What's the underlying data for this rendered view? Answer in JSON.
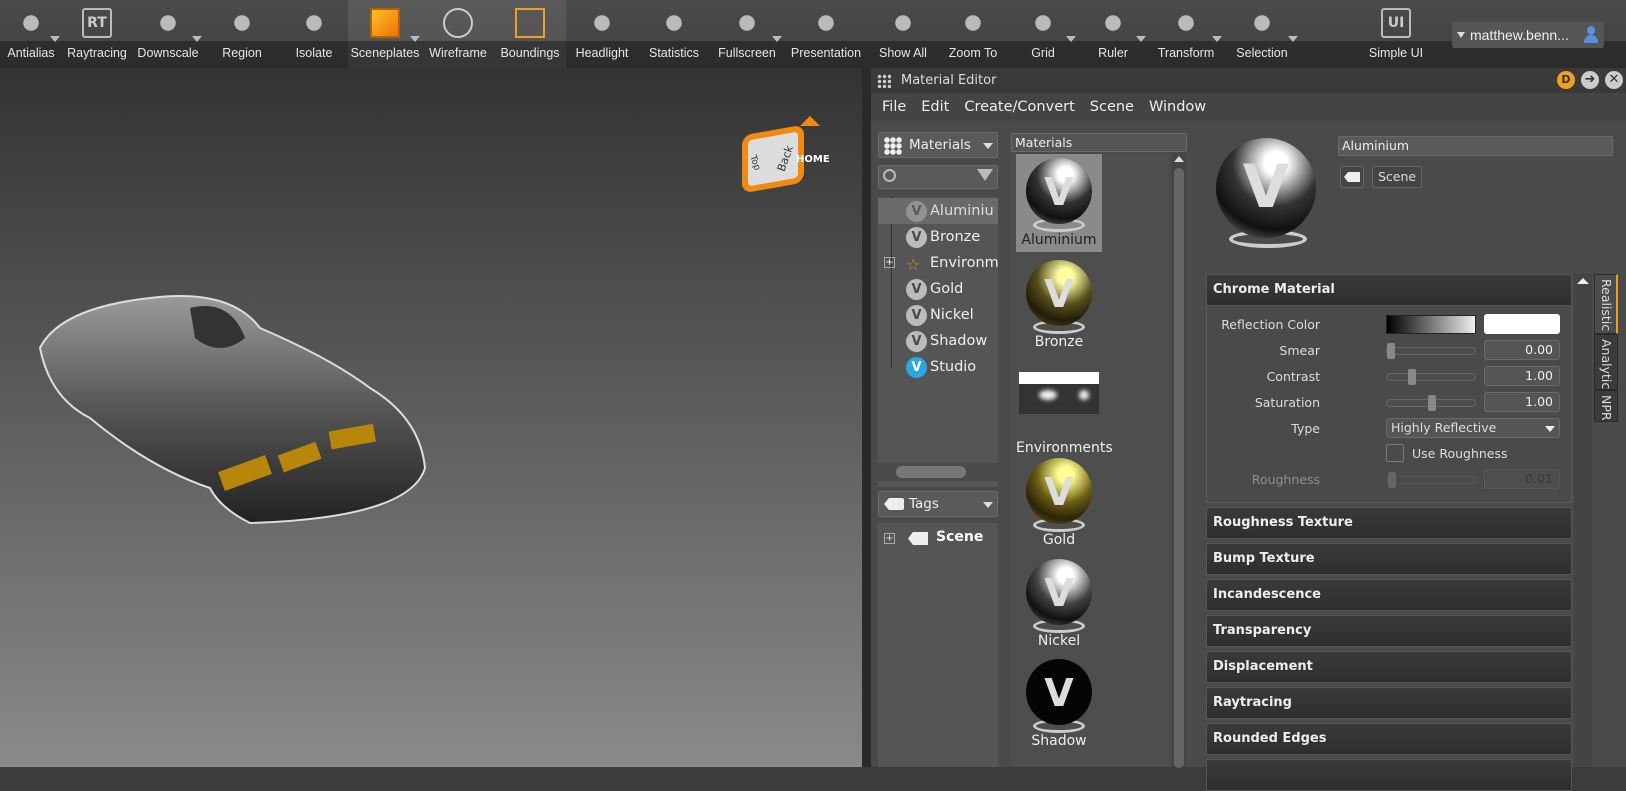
{
  "toolbar": {
    "items": [
      {
        "label": "Antialias",
        "icon": "antialias-grid-icon"
      },
      {
        "label": "Raytracing",
        "icon": "rt-icon",
        "glyph": "RT"
      },
      {
        "label": "Downscale",
        "icon": "downscale-icon"
      },
      {
        "label": "Region",
        "icon": "region-icon"
      },
      {
        "label": "Isolate",
        "icon": "isolate-eye-icon"
      },
      {
        "label": "Sceneplates",
        "icon": "sceneplates-icon"
      },
      {
        "label": "Wireframe",
        "icon": "wireframe-globe-icon"
      },
      {
        "label": "Boundings",
        "icon": "boundings-icon"
      },
      {
        "label": "Headlight",
        "icon": "headlight-icon"
      },
      {
        "label": "Statistics",
        "icon": "statistics-icon"
      },
      {
        "label": "Fullscreen",
        "icon": "fullscreen-icon"
      },
      {
        "label": "Presentation",
        "icon": "presentation-icon"
      },
      {
        "label": "Show All",
        "icon": "show-all-icon"
      },
      {
        "label": "Zoom To",
        "icon": "zoom-to-icon"
      },
      {
        "label": "Grid",
        "icon": "grid-icon"
      },
      {
        "label": "Ruler",
        "icon": "ruler-icon"
      },
      {
        "label": "Transform",
        "icon": "transform-icon"
      },
      {
        "label": "Selection",
        "icon": "selection-icon"
      },
      {
        "label": "Simple UI",
        "icon": "simple-ui-icon",
        "glyph": "UI"
      }
    ],
    "user": "matthew.benn..."
  },
  "viewport": {
    "navcube_home": "HOME",
    "navcube_back": "Back",
    "navcube_top": "Top"
  },
  "editor": {
    "title": "Material Editor",
    "badge": "D",
    "menu": [
      "File",
      "Edit",
      "Create/Convert",
      "Scene",
      "Window"
    ],
    "tree_dropdown": "Materials",
    "tree": [
      "Aluminiu",
      "Bronze",
      "Environm",
      "Gold",
      "Nickel",
      "Shadow",
      "Studio"
    ],
    "tags_dropdown": "Tags",
    "tags_tree": [
      "Scene"
    ],
    "thumbs_header": "Materials",
    "thumbs": [
      "Aluminium",
      "Bronze",
      "Environments",
      "Gold",
      "Nickel",
      "Shadow"
    ],
    "material_name": "Aluminium",
    "tag_button": "Scene",
    "section_title": "Chrome Material",
    "props": {
      "reflection_color_label": "Reflection Color",
      "smear_label": "Smear",
      "smear": "0.00",
      "smear_frac": 0,
      "contrast_label": "Contrast",
      "contrast": "1.00",
      "contrast_frac": 0.25,
      "saturation_label": "Saturation",
      "saturation": "1.00",
      "saturation_frac": 0.5,
      "type_label": "Type",
      "type": "Highly Reflective",
      "use_roughness_label": "Use Roughness",
      "use_roughness": false,
      "roughness_label": "Roughness",
      "roughness": "0.01",
      "roughness_frac": 0.01
    },
    "sections": [
      "Roughness Texture",
      "Bump Texture",
      "Incandescence",
      "Transparency",
      "Displacement",
      "Raytracing",
      "Rounded Edges"
    ],
    "vtabs": [
      "Realistic",
      "Analytic",
      "NPR"
    ]
  },
  "colors": {
    "accent": "#f0a020",
    "bg": "#4a4a4a"
  }
}
